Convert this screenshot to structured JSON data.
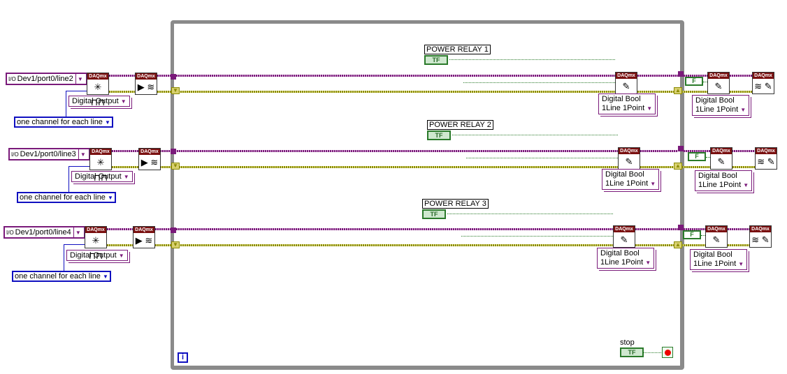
{
  "rows": [
    {
      "channel": "Dev1/port0/line2",
      "type": "Digital Output",
      "grouping": "one channel for each line",
      "control": "POWER RELAY 1",
      "write_mode": "Digital Bool\n1Line 1Point",
      "write_mode2": "Digital Bool\n1Line 1Point"
    },
    {
      "channel": "Dev1/port0/line3",
      "type": "Digital Output",
      "grouping": "one channel for each line",
      "control": "POWER RELAY 2",
      "write_mode": "Digital Bool\n1Line 1Point",
      "write_mode2": "Digital Bool\n1Line 1Point"
    },
    {
      "channel": "Dev1/port0/line4",
      "type": "Digital Output",
      "grouping": "one channel for each line",
      "control": "POWER RELAY 3",
      "write_mode": "Digital Bool\n1Line 1Point",
      "write_mode2": "Digital Bool\n1Line 1Point"
    }
  ],
  "node_header": "DAQmx",
  "bool_control_text": "TF",
  "false_constant_text": "F",
  "stop_label": "stop",
  "iteration_terminal": "i",
  "colors": {
    "task_wire": "#7a1a7a",
    "error_wire": "#8a8a00",
    "loop_border": "#8a8a8a",
    "boolean": "#2a7a2a",
    "enum": "#1010c0",
    "node_header": "#7a1010"
  }
}
